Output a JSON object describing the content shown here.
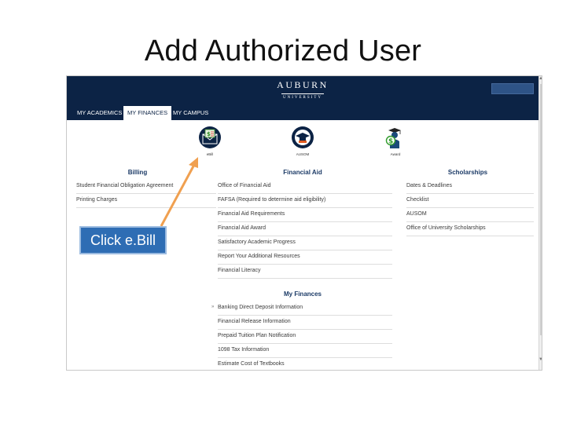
{
  "slide": {
    "title": "Add Authorized User"
  },
  "callout": {
    "label": "Click e.Bill"
  },
  "colors": {
    "navy": "#0c2345",
    "accent_orange": "#f0a050",
    "callout_blue": "#2e6db4",
    "link_header": "#1b3a66"
  },
  "portal": {
    "logo": {
      "main": "AUBURN",
      "sub": "UNIVERSITY"
    },
    "tabs": [
      {
        "label": "MY ACADEMICS",
        "active": false
      },
      {
        "label": "MY FINANCES",
        "active": true
      },
      {
        "label": "MY CAMPUS",
        "active": false
      }
    ],
    "apps": [
      {
        "label": "eBill",
        "icon": "ebill-envelope-icon"
      },
      {
        "label": "AUSOM",
        "icon": "graduation-cap-icon"
      },
      {
        "label": "Award",
        "icon": "graduate-dollar-icon"
      }
    ],
    "billing": {
      "header": "Billing",
      "links": [
        "Student Financial Obligation Agreement",
        "Printing Charges"
      ]
    },
    "financial_aid": {
      "header": "Financial Aid",
      "links": [
        "Office of Financial Aid",
        "FAFSA (Required to determine aid eligibility)",
        "Financial Aid Requirements",
        "Financial Aid Award",
        "Satisfactory Academic Progress",
        "Report Your Additional Resources",
        "Financial Literacy"
      ]
    },
    "scholarships": {
      "header": "Scholarships",
      "links": [
        "Dates & Deadlines",
        "Checklist",
        "AUSOM",
        "Office of University Scholarships"
      ]
    },
    "my_finances": {
      "header": "My Finances",
      "links": [
        "Banking Direct Deposit Information",
        "Financial Release Information",
        "Prepaid Tuition Plan Notification",
        "1098 Tax Information",
        "Estimate Cost of Textbooks"
      ]
    }
  }
}
